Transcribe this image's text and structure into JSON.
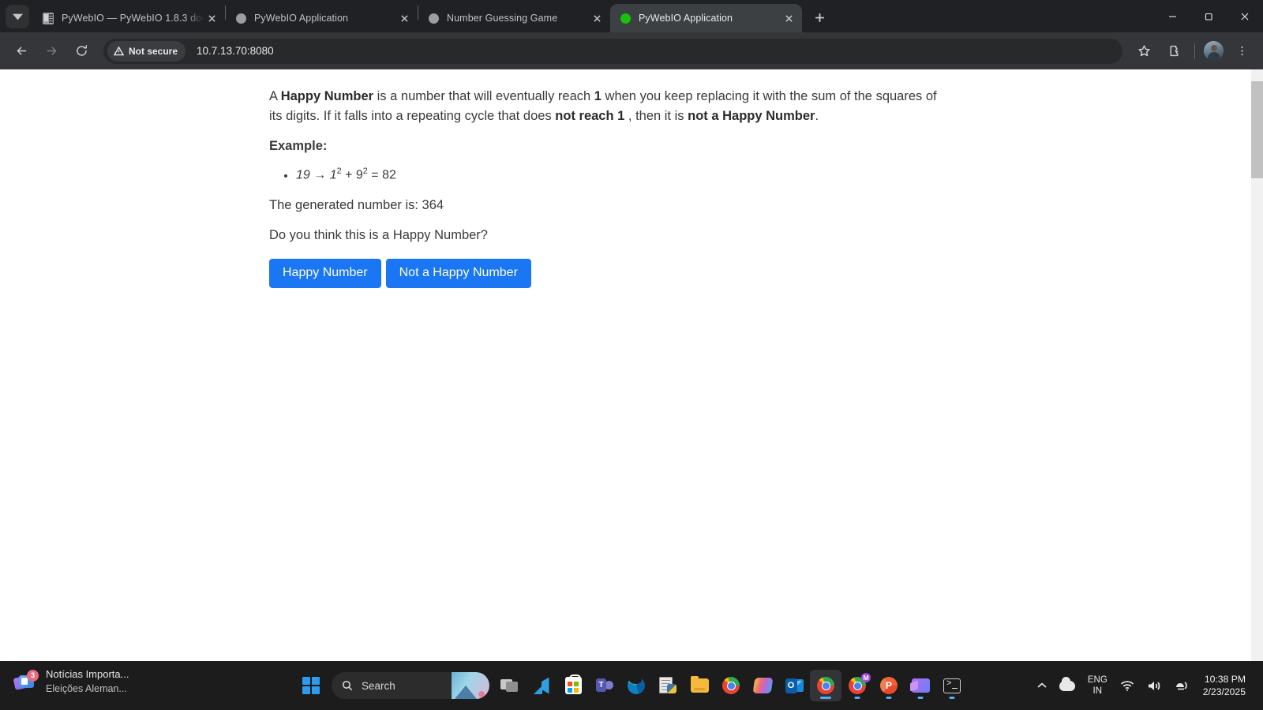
{
  "browser": {
    "tab_search_icon": "chevron-down-icon",
    "tabs": [
      {
        "title": "PyWebIO — PyWebIO 1.8.3 doc",
        "favicon": "doc-favicon",
        "active": false
      },
      {
        "title": "PyWebIO Application",
        "favicon": "gray-dot-favicon",
        "active": false
      },
      {
        "title": "Number Guessing Game",
        "favicon": "gray-dot-favicon",
        "active": false
      },
      {
        "title": "PyWebIO Application",
        "favicon": "green-dot-favicon",
        "active": true
      }
    ],
    "new_tab_label": "+",
    "window_controls": {
      "minimize": "minimize-icon",
      "maximize": "restore-icon",
      "close": "close-icon"
    },
    "toolbar": {
      "back": "back-arrow-icon",
      "forward": "forward-arrow-icon",
      "reload": "reload-icon",
      "security_label": "Not secure",
      "url": "10.7.13.70:8080",
      "bookmark": "star-icon",
      "extensions": "puzzle-icon",
      "profile": "profile-avatar"
    }
  },
  "page": {
    "paragraph1": {
      "p1": "A ",
      "b1": "Happy Number",
      "p2": " is a number that will eventually reach ",
      "b2": "1",
      "p3": " when you keep replacing it with the sum of the squares of its digits. If it falls into a repeating cycle that does ",
      "b3": "not reach 1",
      "p4": " , then it is ",
      "b4": "not a Happy Number",
      "p5": "."
    },
    "example_label": "Example:",
    "example_item": {
      "start": "19 → 1",
      "sup1": "2",
      "mid": " + 9",
      "sup2": "2",
      "end": " = 82"
    },
    "generated_text": "The generated number is: 364",
    "question_text": "Do you think this is a Happy Number?",
    "buttons": [
      {
        "label": "Happy Number",
        "color": "#1a76f2"
      },
      {
        "label": "Not a Happy Number",
        "color": "#1a76f2"
      }
    ],
    "scrollbar": {
      "up_arrow": "scroll-up-arrow-icon"
    }
  },
  "taskbar": {
    "news": {
      "title": "Notícias Importa...",
      "subtitle": "Eleições Aleman...",
      "badge": "3",
      "icon": "news-cards-icon"
    },
    "start_label": "start-button",
    "search_placeholder": "Search",
    "search_icon": "search-icon",
    "apps": [
      {
        "name": "task-view",
        "glyph": "task-view-icon"
      },
      {
        "name": "vs-code",
        "glyph": "vscode-icon"
      },
      {
        "name": "microsoft-store",
        "glyph": "store-icon"
      },
      {
        "name": "microsoft-teams",
        "glyph": "teams-icon"
      },
      {
        "name": "microsoft-edge",
        "glyph": "edge-icon"
      },
      {
        "name": "python-script",
        "glyph": "python-file-icon"
      },
      {
        "name": "file-explorer",
        "glyph": "folder-icon"
      },
      {
        "name": "google-chrome",
        "glyph": "chrome-icon"
      },
      {
        "name": "copilot",
        "glyph": "copilot-icon"
      },
      {
        "name": "outlook",
        "glyph": "outlook-icon"
      },
      {
        "name": "chrome-active",
        "glyph": "chrome-person-icon"
      },
      {
        "name": "chrome-profile-m",
        "glyph": "chrome-m-icon"
      },
      {
        "name": "powerpoint",
        "glyph": "powerpoint-icon"
      },
      {
        "name": "clipchamp",
        "glyph": "clipchamp-icon"
      },
      {
        "name": "terminal",
        "glyph": "terminal-icon"
      }
    ],
    "tray": {
      "chevron": "show-hidden-icons-icon",
      "cloud": "onedrive-icon",
      "lang_line1": "ENG",
      "lang_line2": "IN",
      "wifi": "wifi-icon",
      "volume": "volume-icon",
      "battery_saver": "battery-icon",
      "time": "10:38 PM",
      "date": "2/23/2025"
    }
  }
}
